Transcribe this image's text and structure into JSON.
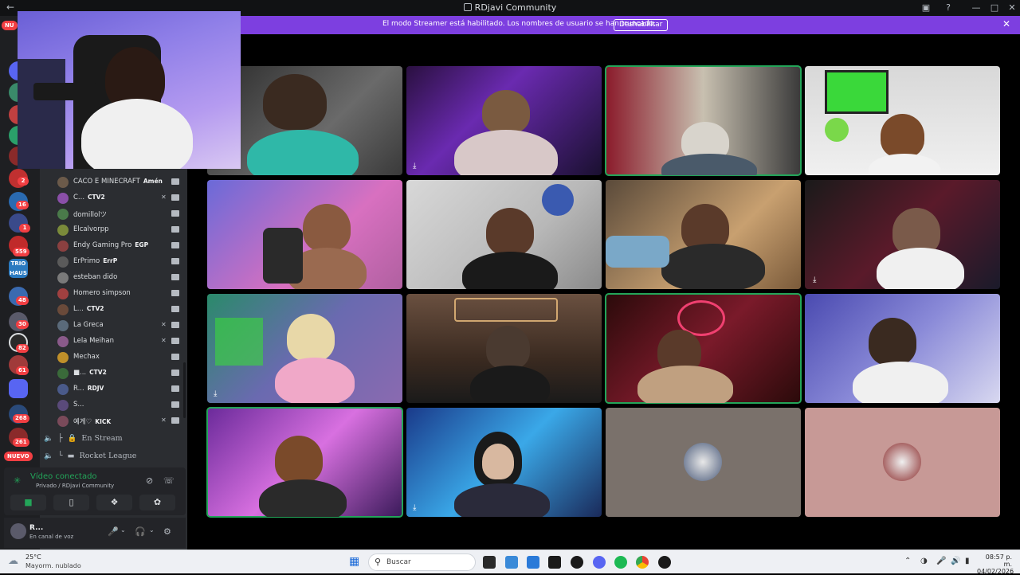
{
  "window": {
    "title": "RDjavi Community"
  },
  "banner": {
    "message": "El modo Streamer está habilitado. Los nombres de usuario se han truncado.",
    "button": "Deshabilitar"
  },
  "rail": {
    "badges": [
      "2",
      "16",
      "1",
      "559",
      "30",
      "48",
      "82",
      "61",
      "268",
      "261"
    ],
    "nuevo_top": "NU",
    "nuevo_bottom": "NUEVO",
    "trio_haus": "TRIO HAUS"
  },
  "members": [
    {
      "name": "CACO E MINECRAFT",
      "tag": "Amén",
      "avatar_color": "#6b5a4a"
    },
    {
      "name": "C...",
      "tag": "CTV2",
      "avatar_color": "#8a4fa8"
    },
    {
      "name": "domillolツ",
      "tag": "",
      "avatar_color": "#4a7a4a"
    },
    {
      "name": "Elcalvorpp",
      "tag": "",
      "avatar_color": "#7a8a3a"
    },
    {
      "name": "Endy Gaming Pro",
      "tag": "EGP",
      "avatar_color": "#8a4040"
    },
    {
      "name": "ErPrimo",
      "tag": "ErrP",
      "avatar_color": "#5a5a5a"
    },
    {
      "name": "esteban dido",
      "tag": "",
      "avatar_color": "#7a7a7a"
    },
    {
      "name": "Homero simpson",
      "tag": "",
      "avatar_color": "#a04040"
    },
    {
      "name": "L...",
      "tag": "CTV2",
      "avatar_color": "#6a4a3a"
    },
    {
      "name": "La Greca",
      "tag": "",
      "avatar_color": "#5a6a7a"
    },
    {
      "name": "Lela Meihan",
      "tag": "",
      "avatar_color": "#8a5a8a"
    },
    {
      "name": "Mechax",
      "tag": "",
      "avatar_color": "#c0902a"
    },
    {
      "name": "■...",
      "tag": "CTV2",
      "avatar_color": "#3a6a3a"
    },
    {
      "name": "R...",
      "tag": "RDJV",
      "avatar_color": "#4a5a8a"
    },
    {
      "name": "S...",
      "tag": "",
      "avatar_color": "#5a4a7a"
    },
    {
      "name": "예게♡",
      "tag": "KICK",
      "avatar_color": "#7a4a5a"
    }
  ],
  "channels": [
    "En Stream",
    "Rocket League"
  ],
  "voice": {
    "status": "Vídeo conectado",
    "location": "Privado / RDjavi Community"
  },
  "user": {
    "name": "R...",
    "status": "En canal de voz"
  },
  "taskbar": {
    "temp": "25°C",
    "weather": "Mayorm. nublado",
    "search": "Buscar",
    "time": "08:57 p. m.",
    "date": "04/02/2026"
  }
}
